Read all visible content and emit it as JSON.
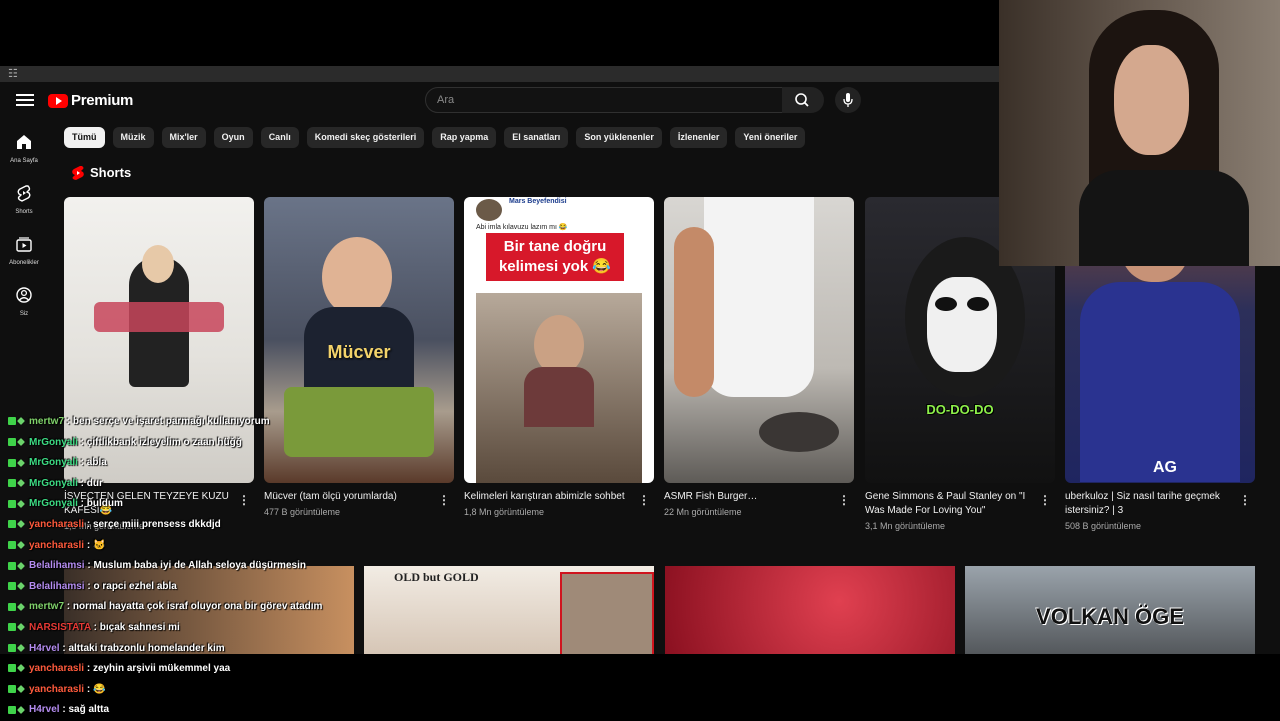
{
  "masthead": {
    "brand": "Premium",
    "search_placeholder": "Ara"
  },
  "sidebar": {
    "items": [
      {
        "label": "Ana Sayfa"
      },
      {
        "label": "Shorts"
      },
      {
        "label": "Abonelikler"
      },
      {
        "label": "Siz"
      }
    ]
  },
  "chips": [
    "Tümü",
    "Müzik",
    "Mix'ler",
    "Oyun",
    "Canlı",
    "Komedi skeç gösterileri",
    "Rap yapma",
    "El sanatları",
    "Son yüklenenler",
    "İzlenenler",
    "Yeni öneriler"
  ],
  "shorts": {
    "title": "Shorts",
    "items": [
      {
        "title": "İSVEÇTEN GELEN TEYZEYE KUZU KAFESİ😂",
        "views": "1,5 Mn görüntüleme",
        "overlay": ""
      },
      {
        "title": "Mücver (tam ölçü yorumlarda)",
        "views": "477 B görüntüleme",
        "overlay": "Mücver"
      },
      {
        "title": "Kelimeleri karıştıran abimizle sohbet",
        "views": "1,8 Mn görüntüleme",
        "overlay": "Bir tane doğru kelimesi yok 😂",
        "post_name": "Mars Beyefendisi",
        "post_text": "Abi imla kılavuzu lazım mı 😂"
      },
      {
        "title": "ASMR Fish Burger…",
        "views": "22 Mn görüntüleme",
        "overlay": ""
      },
      {
        "title": "Gene Simmons & Paul Stanley on \"I Was Made For Loving You\"",
        "views": "3,1 Mn görüntüleme",
        "overlay": "DO-DO-DO"
      },
      {
        "title": "uberkuloz | Siz nasıl tarihe geçmek istersiniz? | 3",
        "views": "508 B görüntüleme",
        "overlay": "AG"
      }
    ]
  },
  "videos": [
    {
      "overlay": ""
    },
    {
      "overlay": "OLD but GOLD"
    },
    {
      "overlay": ""
    },
    {
      "overlay": "VOLKAN ÖGE"
    }
  ],
  "chat": [
    {
      "user": "mertw7",
      "message": "ben serçe ve işaret parmağı kullanıyorum",
      "color": "#7fd16a"
    },
    {
      "user": "MrGonyali",
      "message": "çiftlikbank izleyelim o zaan hüğğ",
      "color": "#3ddc84"
    },
    {
      "user": "MrGonyali",
      "message": "abla",
      "color": "#3ddc84"
    },
    {
      "user": "MrGonyali",
      "message": "dur",
      "color": "#3ddc84"
    },
    {
      "user": "MrGonyali",
      "message": "buldum",
      "color": "#3ddc84"
    },
    {
      "user": "yancharasli",
      "message": "serçe miii prensess dkkdjd",
      "color": "#ff5a3c"
    },
    {
      "user": "yancharasli",
      "message": "🐱",
      "color": "#ff5a3c"
    },
    {
      "user": "Belalihamsi",
      "message": "Muslum baba iyi de Allah seloya düşürmesin",
      "color": "#b48cf0"
    },
    {
      "user": "Belalihamsi",
      "message": "o rapci ezhel abla",
      "color": "#b48cf0"
    },
    {
      "user": "mertw7",
      "message": "normal hayatta çok israf oluyor ona bir görev atadım",
      "color": "#7fd16a"
    },
    {
      "user": "NARSISTATA",
      "message": "bıçak sahnesi mi",
      "color": "#e53935"
    },
    {
      "user": "H4rvel",
      "message": "alttaki trabzonlu homelander kim",
      "color": "#b48cf0"
    },
    {
      "user": "yancharasli",
      "message": "zeyhin arşivii mükemmel yaa",
      "color": "#ff5a3c"
    },
    {
      "user": "yancharasli",
      "message": "😂",
      "color": "#ff5a3c"
    },
    {
      "user": "H4rvel",
      "message": "sağ altta",
      "color": "#b48cf0"
    }
  ]
}
